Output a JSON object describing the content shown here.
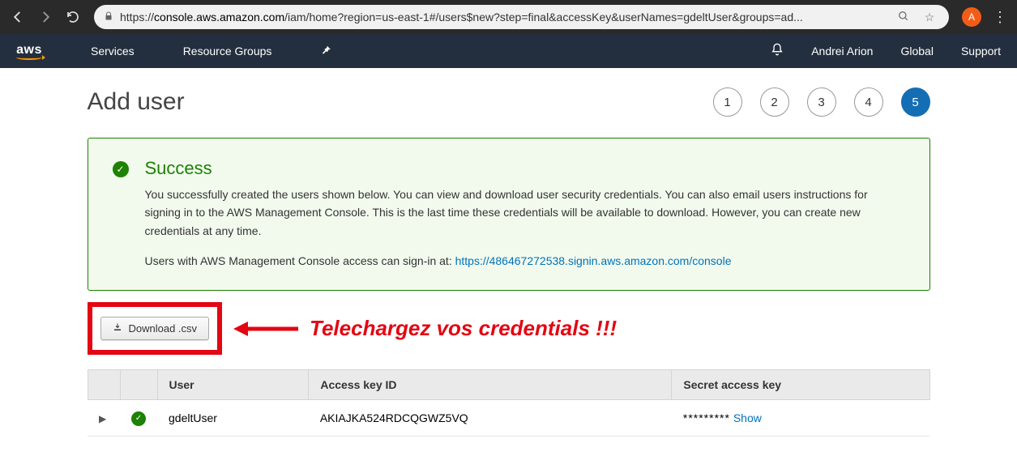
{
  "browser": {
    "url_prefix": "https://",
    "url_host": "console.aws.amazon.com",
    "url_rest": "/iam/home?region=us-east-1#/users$new?step=final&accessKey&userNames=gdeltUser&groups=ad...",
    "avatar_letter": "A"
  },
  "nav": {
    "logo": "aws",
    "services": "Services",
    "resource_groups": "Resource Groups",
    "user": "Andrei Arion",
    "region": "Global",
    "support": "Support"
  },
  "page": {
    "title": "Add user",
    "steps": [
      "1",
      "2",
      "3",
      "4",
      "5"
    ],
    "active_step": 5
  },
  "success": {
    "title": "Success",
    "body": "You successfully created the users shown below. You can view and download user security credentials. You can also email users instructions for signing in to the AWS Management Console. This is the last time these credentials will be available to download. However, you can create new credentials at any time.",
    "signin_prefix": "Users with AWS Management Console access can sign-in at: ",
    "signin_url": "https://486467272538.signin.aws.amazon.com/console"
  },
  "download": {
    "button": "Download .csv",
    "callout": "Telechargez vos credentials !!!"
  },
  "table": {
    "headers": {
      "user": "User",
      "akid": "Access key ID",
      "secret": "Secret access key"
    },
    "rows": [
      {
        "user": "gdeltUser",
        "akid": "AKIAJKA524RDCQGWZ5VQ",
        "secret_mask": "*********",
        "show": "Show"
      }
    ]
  }
}
